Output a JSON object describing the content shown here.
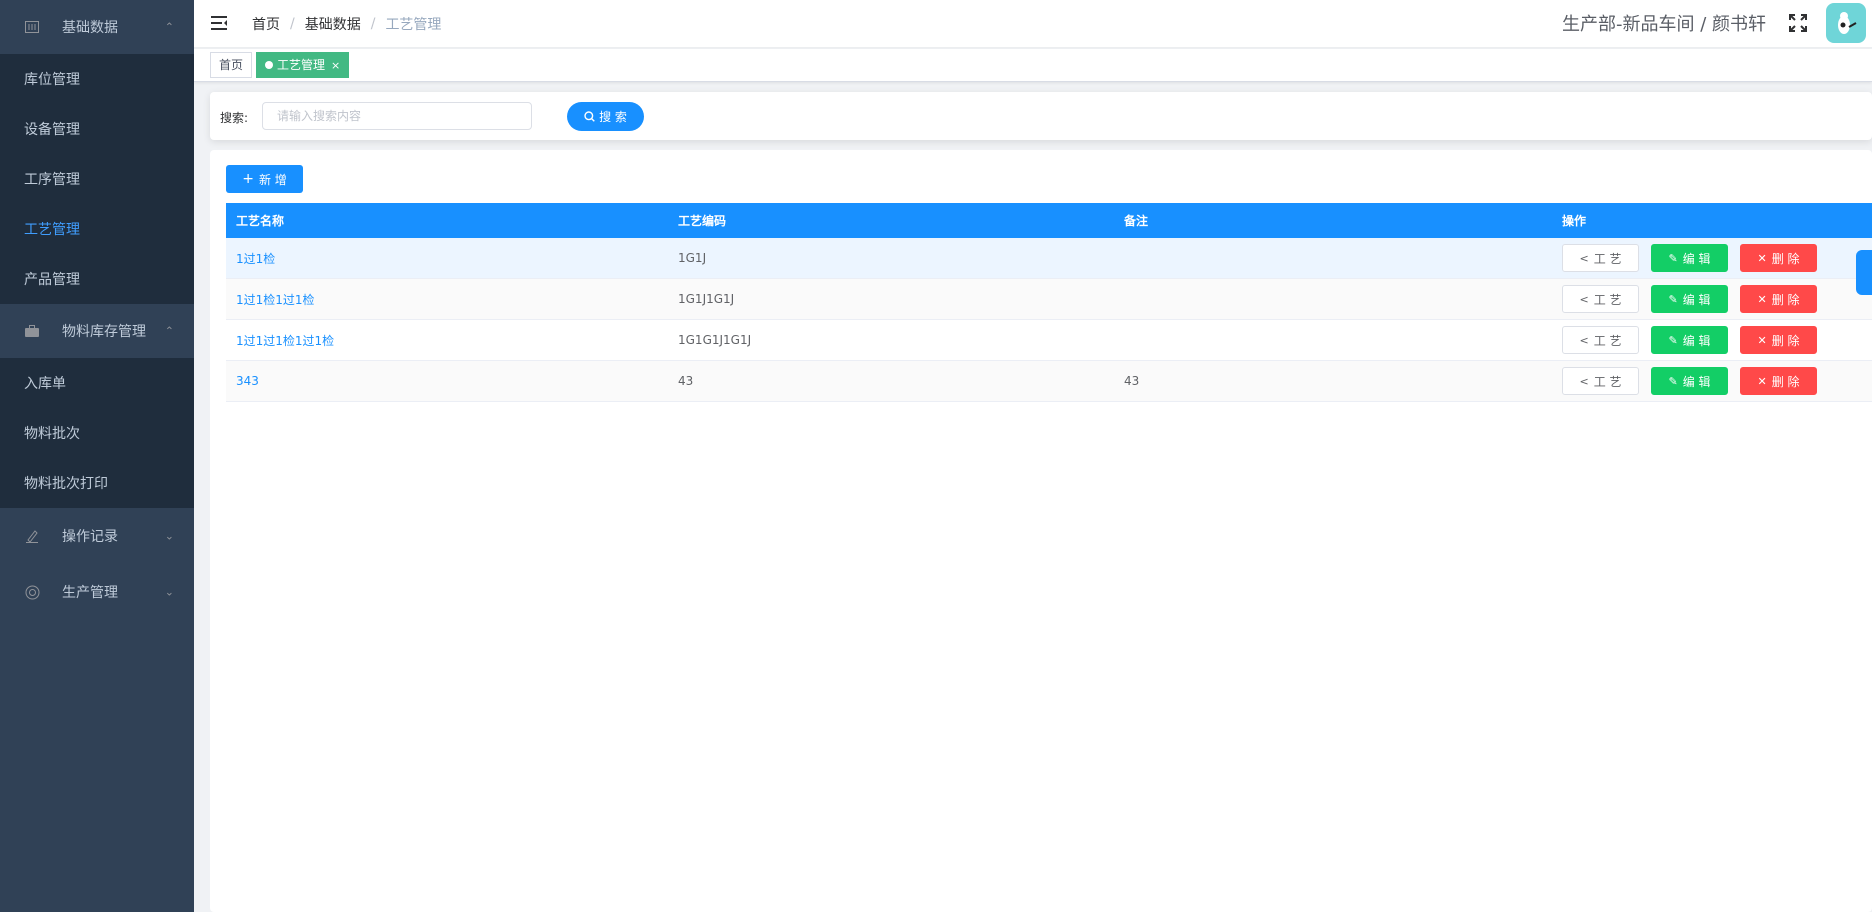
{
  "sidebar": {
    "groups": [
      {
        "label": "基础数据",
        "icon": "database-icon",
        "items": [
          {
            "label": "库位管理"
          },
          {
            "label": "设备管理"
          },
          {
            "label": "工序管理"
          },
          {
            "label": "工艺管理"
          },
          {
            "label": "产品管理"
          }
        ]
      },
      {
        "label": "物料库存管理",
        "icon": "briefcase-icon",
        "items": [
          {
            "label": "入库单"
          },
          {
            "label": "物料批次"
          },
          {
            "label": "物料批次打印"
          }
        ]
      },
      {
        "label": "操作记录",
        "icon": "pen-icon"
      },
      {
        "label": "生产管理",
        "icon": "lifebuoy-icon"
      }
    ],
    "active_item": "工艺管理"
  },
  "breadcrumb": [
    "首页",
    "基础数据",
    "工艺管理"
  ],
  "header": {
    "user_text": "生产部-新品车间 / 颜书轩"
  },
  "tags": [
    {
      "label": "首页"
    },
    {
      "label": "工艺管理",
      "close": "×"
    }
  ],
  "search": {
    "label": "搜索:",
    "placeholder": "请输入搜索内容",
    "button_label": "搜 索"
  },
  "toolbar": {
    "add_label": "新 增"
  },
  "table": {
    "columns": [
      "工艺名称",
      "工艺编码",
      "备注",
      "操作"
    ],
    "rows": [
      {
        "name": "1过1检",
        "code": "1G1J",
        "remark": ""
      },
      {
        "name": "1过1检1过1检",
        "code": "1G1J1G1J",
        "remark": ""
      },
      {
        "name": "1过1过1检1过1检",
        "code": "1G1G1J1G1J",
        "remark": ""
      },
      {
        "name": "343",
        "code": "43",
        "remark": "43"
      }
    ],
    "actions": {
      "craft": "工 艺",
      "edit": "编 辑",
      "delete": "删 除"
    }
  },
  "colors": {
    "sidebar_bg": "#304156",
    "submenu_bg": "#1f2d3d",
    "primary": "#1890ff",
    "active_tag": "#42b983",
    "success": "#13ce66",
    "danger": "#ff4949"
  }
}
